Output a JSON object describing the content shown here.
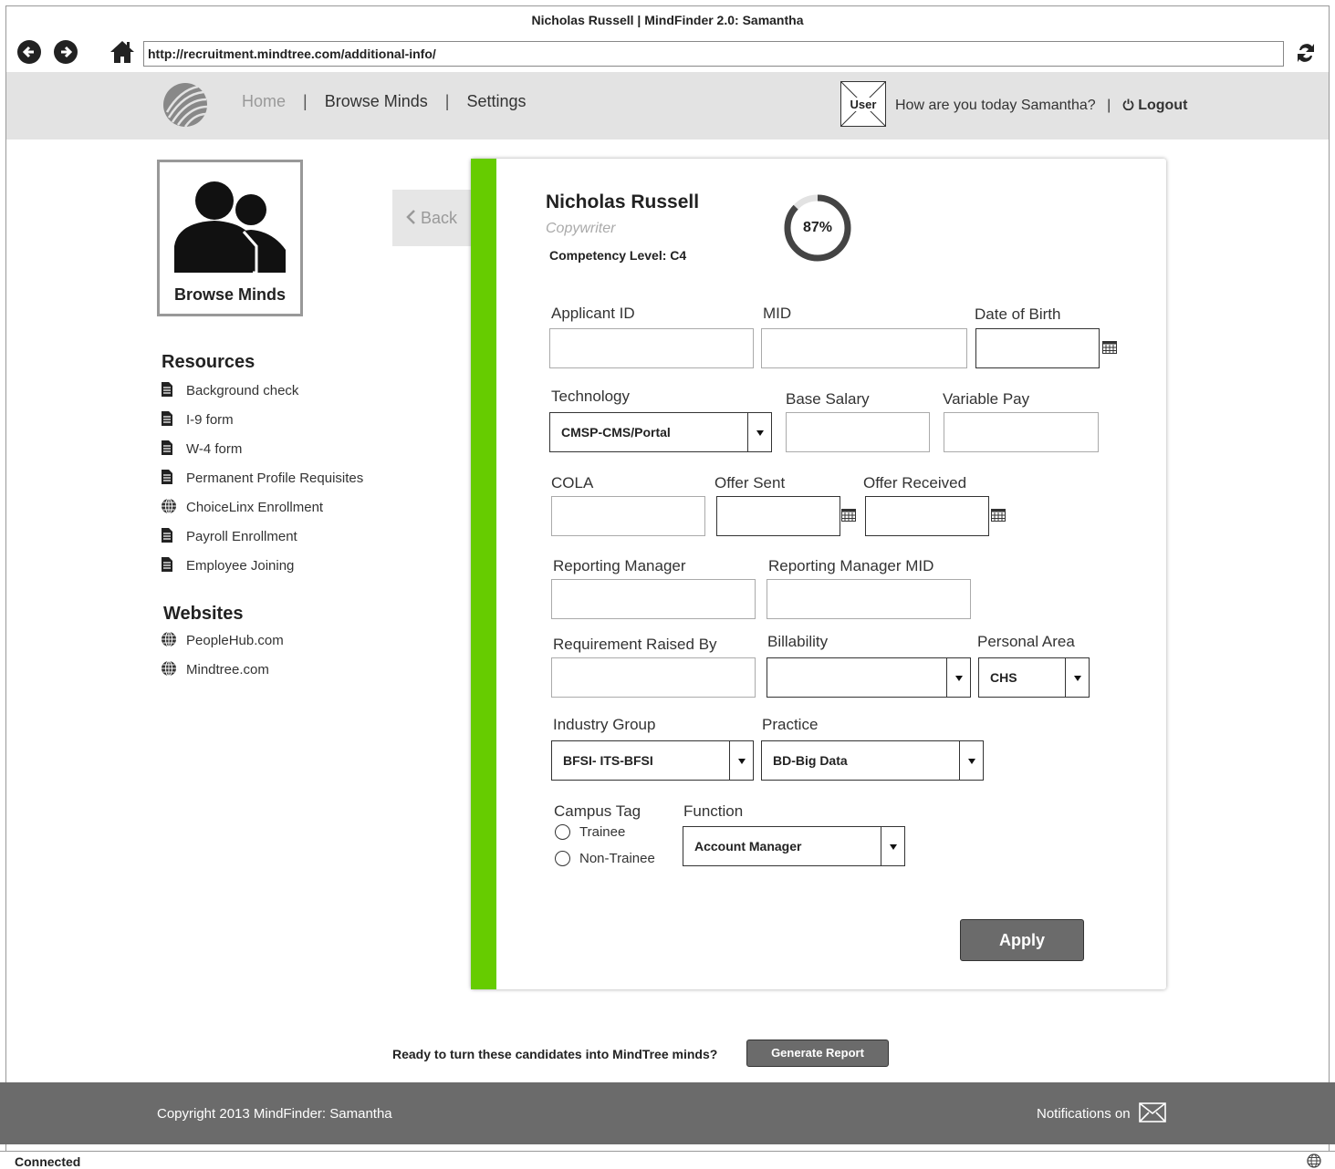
{
  "window": {
    "title": "Nicholas Russell | MindFinder 2.0: Samantha"
  },
  "browser": {
    "url": "http://recruitment.mindtree.com/additional-info/"
  },
  "topnav": {
    "home": "Home",
    "sep": "|",
    "browse": "Browse Minds",
    "settings": "Settings"
  },
  "user": {
    "avatar_label": "User",
    "greeting": "How are you today Samantha?",
    "sep": "|",
    "logout": "Logout"
  },
  "sidebar": {
    "card_label": "Browse Minds",
    "resources_title": "Resources",
    "resources": [
      {
        "label": "Background check",
        "icon": "document-icon"
      },
      {
        "label": "I-9 form",
        "icon": "document-icon"
      },
      {
        "label": "W-4 form",
        "icon": "document-icon"
      },
      {
        "label": "Permanent Profile Requisites",
        "icon": "document-icon"
      },
      {
        "label": "ChoiceLinx Enrollment",
        "icon": "globe-icon"
      },
      {
        "label": "Payroll Enrollment",
        "icon": "document-icon"
      },
      {
        "label": "Employee Joining",
        "icon": "document-icon"
      }
    ],
    "websites_title": "Websites",
    "websites": [
      {
        "label": "PeopleHub.com",
        "icon": "globe-icon"
      },
      {
        "label": "Mindtree.com",
        "icon": "globe-icon"
      }
    ]
  },
  "back": {
    "label": "Back"
  },
  "profile": {
    "name": "Nicholas Russell",
    "role": "Copywriter",
    "competency": "Competency Level: C4",
    "completion_label": "87%",
    "completion": 0.87
  },
  "form": {
    "applicant_id": {
      "label": "Applicant ID",
      "value": ""
    },
    "mid": {
      "label": "MID",
      "value": ""
    },
    "dob": {
      "label": "Date of Birth",
      "value": ""
    },
    "technology": {
      "label": "Technology",
      "value": "CMSP-CMS/Portal"
    },
    "base_salary": {
      "label": "Base Salary",
      "value": ""
    },
    "variable_pay": {
      "label": "Variable Pay",
      "value": ""
    },
    "cola": {
      "label": "COLA",
      "value": ""
    },
    "offer_sent": {
      "label": "Offer Sent",
      "value": ""
    },
    "offer_received": {
      "label": "Offer Received",
      "value": ""
    },
    "reporting_manager": {
      "label": "Reporting Manager",
      "value": ""
    },
    "reporting_manager_mid": {
      "label": "Reporting Manager MID",
      "value": ""
    },
    "requirement_raised_by": {
      "label": "Requirement Raised By",
      "value": ""
    },
    "billability": {
      "label": "Billability",
      "value": ""
    },
    "personal_area": {
      "label": "Personal Area",
      "value": "CHS"
    },
    "industry_group": {
      "label": "Industry Group",
      "value": "BFSI- ITS-BFSI"
    },
    "practice": {
      "label": "Practice",
      "value": "BD-Big Data"
    },
    "campus_tag": {
      "label": "Campus Tag",
      "options": [
        "Trainee",
        "Non-Trainee"
      ]
    },
    "function": {
      "label": "Function",
      "value": "Account Manager"
    },
    "apply": "Apply"
  },
  "cta": {
    "text": "Ready to turn these candidates into MindTree minds?",
    "button": "Generate Report"
  },
  "footer": {
    "copyright": "Copyright 2013 MindFinder: Samantha",
    "notifications": "Notifications on"
  },
  "status": {
    "text": "Connected"
  },
  "colors": {
    "accent": "#66cc00",
    "header_bg": "#e3e3e3",
    "footer_bg": "#6b6b6b"
  }
}
